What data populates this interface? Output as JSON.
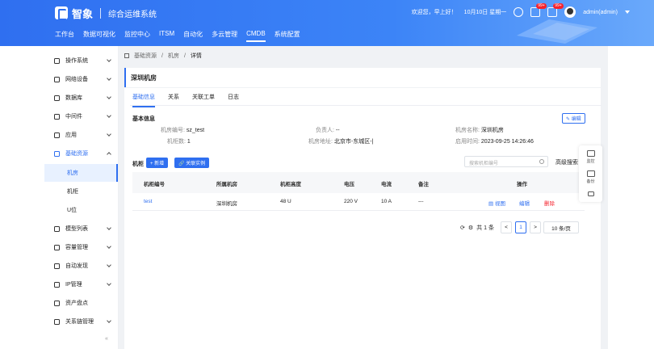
{
  "header": {
    "brand_name": "智象",
    "brand_sub": "综合运维系统",
    "greeting": "欢迎您，早上好！",
    "date": "10月10日 星期一",
    "badge_1": "99+",
    "badge_2": "99+",
    "user": "admin(admin)"
  },
  "nav": [
    "工作台",
    "数据可视化",
    "监控中心",
    "ITSM",
    "自动化",
    "多云管理",
    "CMDB",
    "系统配置"
  ],
  "sidebar": {
    "items": [
      "操作系统",
      "网络设备",
      "数据库",
      "中间件",
      "应用",
      "基础资源"
    ],
    "sub_items": [
      "机房",
      "机柜",
      "U位"
    ],
    "items_bottom": [
      "模型列表",
      "容量管理",
      "自动发现",
      "IP管理",
      "资产盘点",
      "关系链管理"
    ],
    "collapse": "«"
  },
  "breadcrumb": [
    "基础资源",
    "/",
    "机房",
    "/",
    "详情"
  ],
  "panel_title": "深圳机房",
  "tabs": [
    "基础信息",
    "关系",
    "关联工单",
    "日志"
  ],
  "basic": {
    "title": "基本信息",
    "edit": "编辑",
    "room_code_label": "机房编号:",
    "room_code": "sz_test",
    "owner_label": "负责人:",
    "owner": "--",
    "room_name_label": "机房名称:",
    "room_name": "深圳机房",
    "cabinet_count_label": "机柜数:",
    "cabinet_count": "1",
    "address_label": "机房地址:",
    "address": "北京市-东城区-|",
    "enable_time_label": "启用时间:",
    "enable_time": "2023-09-25 14:26:46"
  },
  "cabinet": {
    "title": "机柜",
    "add": "+ 新增",
    "link": "关联实例",
    "search_placeholder": "搜索机柜编号",
    "advanced": "高级搜索",
    "columns": [
      "机柜编号",
      "所属机房",
      "机柜高度",
      "电压",
      "电流",
      "备注",
      "操作"
    ],
    "rows": [
      {
        "code": "test",
        "room": "深圳机房",
        "height": "48 U",
        "voltage": "220 V",
        "current": "10 A",
        "note": "---",
        "view": "视图",
        "edit": "编辑",
        "delete": "删除"
      }
    ]
  },
  "pagination": {
    "total": "共 1 条",
    "prev": "<",
    "page": "1",
    "next": ">",
    "page_size": "10 条/页"
  },
  "float": [
    "监控",
    "备份"
  ]
}
